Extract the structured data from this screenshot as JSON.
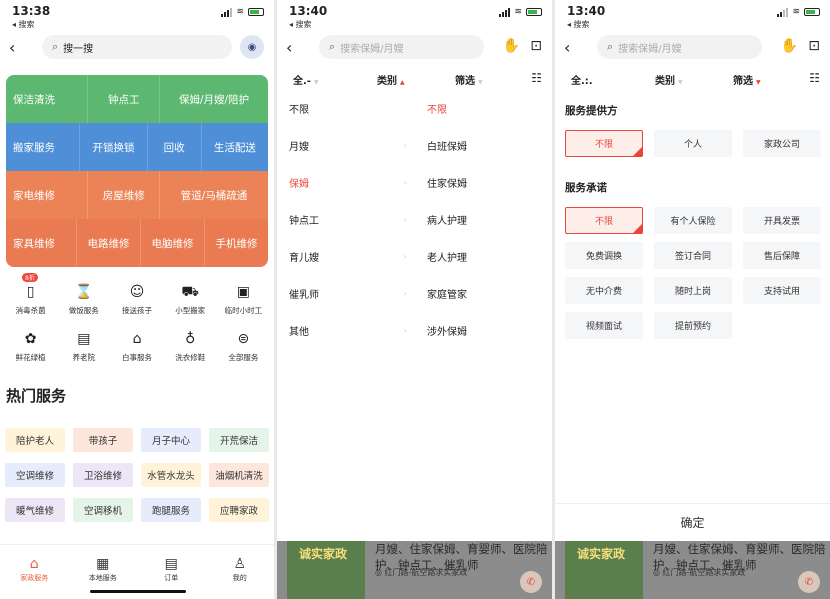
{
  "screens": [
    {
      "time": "13:38",
      "back_app": "◂ 搜索"
    },
    {
      "time": "13:40",
      "back_app": "◂ 搜索"
    },
    {
      "time": "13:40",
      "back_app": "◂ 搜索"
    }
  ],
  "home": {
    "search_value": "搜一搜",
    "grid": [
      [
        "保洁清洗",
        "钟点工",
        "保姆/月嫂/陪护"
      ],
      [
        "搬家服务",
        "开锁换锁",
        "回收",
        "生活配送"
      ],
      [
        "家电维修",
        "房屋维修",
        "管道/马桶疏通"
      ],
      [
        "家具维修",
        "电路维修",
        "电脑维修",
        "手机维修"
      ]
    ],
    "icon_menu": [
      {
        "label": "消毒杀菌",
        "icon": "disinfect-icon",
        "glyph": "▯",
        "badge": "8折"
      },
      {
        "label": "做饭服务",
        "icon": "cooking-icon",
        "glyph": "⌛"
      },
      {
        "label": "接送孩子",
        "icon": "child-pickup-icon",
        "glyph": "☺"
      },
      {
        "label": "小型搬家",
        "icon": "truck-icon",
        "glyph": "⛟"
      },
      {
        "label": "临时小时工",
        "icon": "hourly-worker-icon",
        "glyph": "▣"
      },
      {
        "label": "鲜花绿植",
        "icon": "flower-icon",
        "glyph": "✿"
      },
      {
        "label": "养老院",
        "icon": "nursing-home-icon",
        "glyph": "▤"
      },
      {
        "label": "白事服务",
        "icon": "funeral-icon",
        "glyph": "⌂"
      },
      {
        "label": "洗衣修鞋",
        "icon": "laundry-icon",
        "glyph": "♁"
      },
      {
        "label": "全部服务",
        "icon": "all-services-icon",
        "glyph": "⊜"
      }
    ],
    "hot_title": "热门服务",
    "hot": [
      "陪护老人",
      "带孩子",
      "月子中心",
      "开荒保洁",
      "空调维修",
      "卫浴维修",
      "水管水龙头",
      "油烟机清洗",
      "暖气维修",
      "空调移机",
      "跑腿服务",
      "应聘家政"
    ],
    "tabs": [
      {
        "label": "家政服务",
        "icon": "home-icon",
        "glyph": "⌂"
      },
      {
        "label": "本地服务",
        "icon": "grid-icon",
        "glyph": "▦"
      },
      {
        "label": "订单",
        "icon": "order-icon",
        "glyph": "▤"
      },
      {
        "label": "我的",
        "icon": "user-icon",
        "glyph": "♙"
      }
    ]
  },
  "category_screen": {
    "search_placeholder": "搜索保姆/月嫂",
    "filter_all": "全.-",
    "filter_category": "类别",
    "filter_screen": "筛选",
    "left_list": [
      "不限",
      "月嫂",
      "保姆",
      "钟点工",
      "育儿嫂",
      "催乳师",
      "其他"
    ],
    "left_selected": 2,
    "right_list": [
      "不限",
      "白班保姆",
      "住家保姆",
      "病人护理",
      "老人护理",
      "家庭管家",
      "涉外保姆"
    ],
    "right_selected": 0
  },
  "filter_screen": {
    "search_placeholder": "搜索保姆/月嫂",
    "filter_all": "全.:.",
    "filter_category": "类别",
    "filter_screen": "筛选",
    "provider_title": "服务提供方",
    "providers": [
      "不限",
      "个人",
      "家政公司"
    ],
    "promise_title": "服务承诺",
    "promises": [
      "不限",
      "有个人保险",
      "开具发票",
      "免费调换",
      "签订合同",
      "售后保障",
      "无中介费",
      "随时上岗",
      "支持试用",
      "视频面试",
      "提前预约"
    ],
    "confirm": "确定"
  },
  "ad": {
    "logo": "诚实家政",
    "text_1": "月嫂、住家保姆、育婴师、医院陪",
    "text_2": "护、钟点工、催乳师",
    "address": "◎ 红门路-航空路求实家政"
  },
  "colors": {
    "accent": "#e8463b",
    "green": "#5cb870",
    "blue": "#4f8fd8",
    "orange": "#eb8356"
  }
}
